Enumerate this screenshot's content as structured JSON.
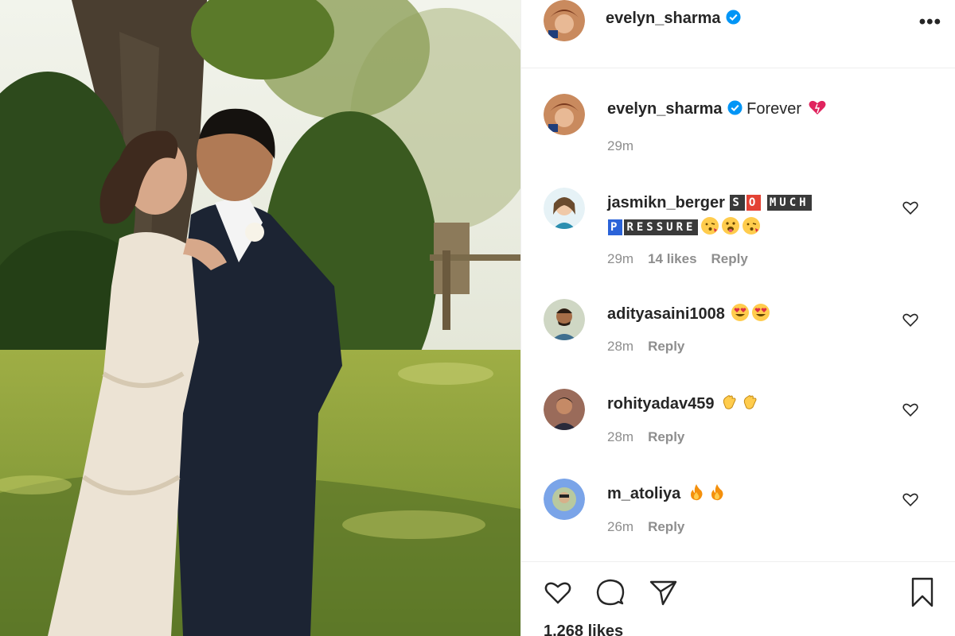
{
  "post": {
    "author": "evelyn_sharma",
    "verified": true,
    "caption": "Forever",
    "caption_emoji": "heart-emoji",
    "caption_time": "29m",
    "likes": "1,268 likes"
  },
  "comments": [
    {
      "user": "jasmikn_berger",
      "tags_line1": [
        "S",
        "O",
        "MUCH"
      ],
      "tags_line2": [
        "P",
        "RESSURE"
      ],
      "emojis": [
        "face-kiss-emoji",
        "face-tongue-emoji",
        "face-kiss-emoji"
      ],
      "time": "29m",
      "likes": "14 likes",
      "reply": "Reply"
    },
    {
      "user": "adityasaini1008",
      "emojis": [
        "heart-eyes-emoji",
        "heart-eyes-emoji"
      ],
      "time": "28m",
      "reply": "Reply"
    },
    {
      "user": "rohityadav459",
      "emojis": [
        "clap-emoji",
        "clap-emoji"
      ],
      "time": "28m",
      "reply": "Reply"
    },
    {
      "user": "m_atoliya",
      "emojis": [
        "fire-emoji",
        "fire-emoji"
      ],
      "time": "26m",
      "reply": "Reply"
    }
  ],
  "icons": [
    "like-icon",
    "comment-icon",
    "share-icon",
    "save-icon",
    "more-icon",
    "verified-icon"
  ],
  "colors": {
    "accent": "#0095f6",
    "muted": "#8e8e8e",
    "text": "#262626",
    "like_red": "#ed4956"
  }
}
